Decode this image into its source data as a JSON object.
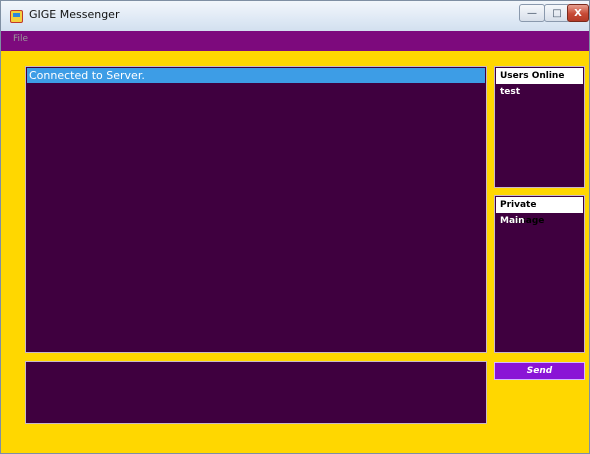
{
  "window": {
    "title": "GIGE Messenger",
    "controls": {
      "minimize": "—",
      "maximize": "□",
      "close": "X"
    }
  },
  "menu": {
    "file_label": "File"
  },
  "chat": {
    "messages": [
      "Connected to Server."
    ]
  },
  "users_online": {
    "header": "Users Online",
    "users": [
      "test"
    ]
  },
  "private_message": {
    "header": "Private Message",
    "targets": [
      "Main"
    ]
  },
  "message_input": {
    "value": ""
  },
  "send": {
    "label": "Send"
  },
  "colors": {
    "client_background": "#ffd700",
    "menubar": "#7d0a7d",
    "panel": "#3f003f",
    "selection": "#3d9de6",
    "send_button": "#8a14d6"
  },
  "icons": {
    "app": "app-icon"
  }
}
